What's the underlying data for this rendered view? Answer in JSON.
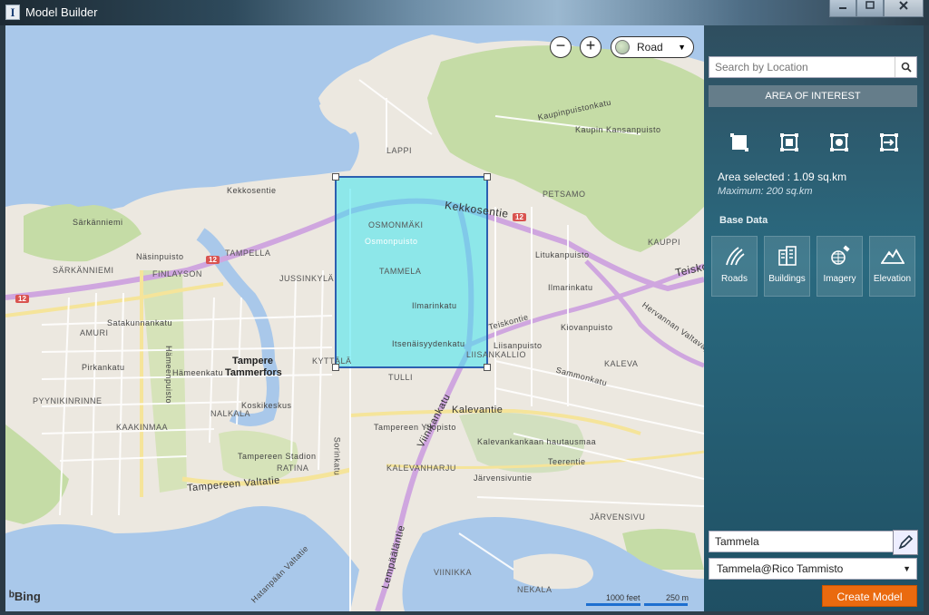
{
  "window": {
    "title": "Model Builder",
    "app_icon": "I",
    "buttons": [
      "minimize-icon",
      "maximize-icon",
      "close-icon"
    ]
  },
  "map": {
    "map_type": "Road",
    "zoom_out": "−",
    "zoom_in": "+",
    "provider": "Bing",
    "scale_feet": "1000 feet",
    "scale_m": "250 m",
    "highlight_color": "#40e6f0",
    "labels": {
      "lappi": "LAPPI",
      "petsamo": "PETSAMO",
      "kauppi": "KAUPPI",
      "osmonmaki": "OSMONMÄKI",
      "osmonpuisto": "Osmonpuisto",
      "tammela": "TAMMELA",
      "tampella": "TAMPELLA",
      "jussinkyla": "JUSSINKYLÄ",
      "sarkanniemi": "SÄRKÄNNIEMI",
      "finlayson": "FINLAYSON",
      "amuri": "AMURI",
      "pyynikinrinne": "PYYNIKINRINNE",
      "kaakinmaa": "KAAKINMAA",
      "nalkala": "NALKALA",
      "ratina": "RATINA",
      "tulli": "TULLI",
      "kyttala": "KYTTÄLÄ",
      "liisankallio": "LIISANKALLIO",
      "kaleva": "KALEVA",
      "kalevanharju": "KALEVANHARJU",
      "jarvensivu": "JÄRVENSIVU",
      "viinikka": "VIINIKKA",
      "nekala": "NEKALA",
      "tampere": "Tampere",
      "tammerfors": "Tammerfors",
      "kekkosentie": "Kekkosentie",
      "kekkosentie_small": "Kekkosentie",
      "teiskontie": "Teiskontie",
      "teisko": "Teisko",
      "viinikankatu": "Viinikankatu",
      "kalevantie": "Kalevantie",
      "lempaalantie": "Lempääläntie",
      "hervannan": "Hervannan Valtaväylä",
      "tampereen_valtatie": "Tampereen Valtatie",
      "satakunnankatu": "Satakunnankatu",
      "hameenkatu": "Hämeenkatu",
      "pirkankatu": "Pirkankatu",
      "hameenpuisto": "Hämeenpuisto",
      "ilmarinkatu": "Ilmarinkatu",
      "itsenaisyydenkatu": "Itsenäisyydenkatu",
      "kaupin_kansanpuisto": "Kaupin Kansanpuisto",
      "kalevankankaan": "Kalevankankaan hautausmaa",
      "tampereen_yliopisto": "Tampereen Yliopisto",
      "tampereen_stadion": "Tampereen Stadion",
      "sammonkatu": "Sammonkatu",
      "litukanpuisto": "Litukanpuisto",
      "kiovanpuisto": "Kiovanpuisto",
      "liisanpuisto": "Liisanpuisto",
      "nasinpuisto": "Näsinpuisto",
      "sarkanniemi_small": "Särkänniemi",
      "koskikeskus": "Koskikeskus",
      "jarvensivuntie": "Järvensivuntie",
      "teerentie": "Teerentie",
      "sorinkatu": "Sorinkatu",
      "hatanpaan": "Hatanpään Valtatie",
      "ilmarinkatu2": "Ilmarinkatu",
      "kaupinpuistonkatu": "Kaupinpuistonkatu",
      "kekkosentie_w": "Kekkosentie",
      "route_12": "12"
    }
  },
  "panel": {
    "search_placeholder": "Search by Location",
    "aoi_title": "AREA OF INTEREST",
    "area_selected": "Area selected : 1.09 sq.km",
    "maximum": "Maximum: 200 sq.km",
    "base_data_title": "Base Data",
    "tools": [
      "rectangle-select-icon",
      "rectangle-center-icon",
      "rectangle-point-icon",
      "import-area-icon"
    ],
    "base_data": [
      {
        "label": "Roads",
        "icon": "roads-icon"
      },
      {
        "label": "Buildings",
        "icon": "buildings-icon"
      },
      {
        "label": "Imagery",
        "icon": "imagery-icon"
      },
      {
        "label": "Elevation",
        "icon": "elevation-icon"
      }
    ],
    "model_name": "Tammela",
    "account": "Tammela@Rico Tammisto",
    "create_label": "Create Model",
    "accent_color": "#ea6a0f"
  }
}
